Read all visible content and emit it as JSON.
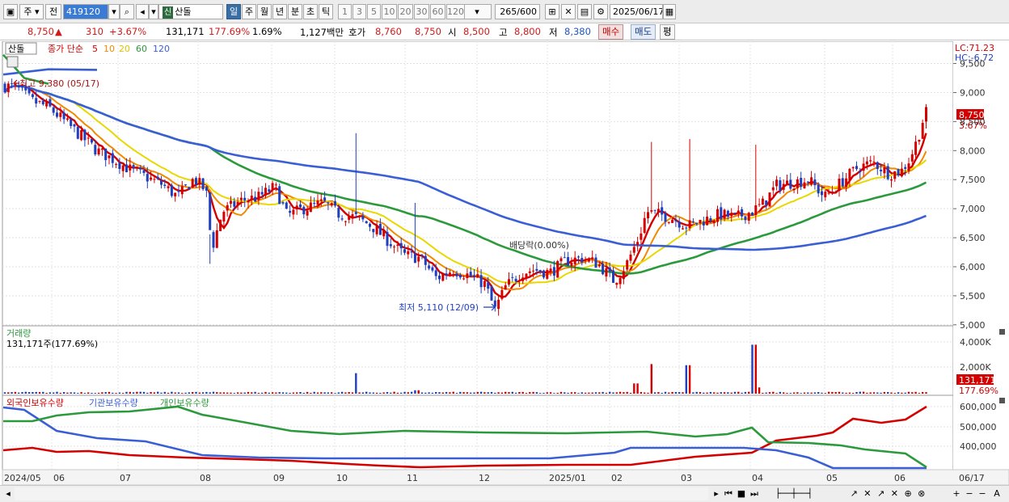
{
  "toolbar": {
    "type_value": "주",
    "type2_value": "전",
    "code_value": "419120",
    "badge": "신",
    "stock_name": "산돌",
    "periods": [
      "일",
      "주",
      "월",
      "년",
      "분",
      "초",
      "틱"
    ],
    "active_period": "일",
    "intervals": [
      "1",
      "3",
      "5",
      "10",
      "20",
      "30",
      "60",
      "120"
    ],
    "count_value": "265",
    "count_total": "/600",
    "date_value": "2025/06/17"
  },
  "info": {
    "price": "8,750",
    "up_arrow": "▲",
    "change": "310",
    "change_pct": "+3.67%",
    "volume": "131,171",
    "volume_pct": "177.69%",
    "turnover_pct": "1.69%",
    "amount": "1,127백만",
    "quote_label": "호가",
    "quote_ask": "8,760",
    "quote_bid": "8,750",
    "open_label": "시",
    "open_value": "8,500",
    "high_label": "고",
    "high_value": "8,800",
    "low_label": "저",
    "low_value": "8,380",
    "buy_button": "매수",
    "sell_button": "매도",
    "eval_button": "평"
  },
  "chart_data": [
    {
      "type": "candlestick",
      "title": "산돌",
      "legend": {
        "prefix": "종가 단순",
        "series": [
          {
            "name": "5",
            "color": "#d40000"
          },
          {
            "name": "10",
            "color": "#f08a00"
          },
          {
            "name": "20",
            "color": "#e8d800"
          },
          {
            "name": "60",
            "color": "#2c9a3c"
          },
          {
            "name": "120",
            "color": "#3a5fd5"
          }
        ]
      },
      "ylim": [
        4900,
        9800
      ],
      "yticks": [
        "9,500",
        "9,000",
        "8,500",
        "8,000",
        "7,500",
        "7,000",
        "6,500",
        "6,000",
        "5,500",
        "5,000"
      ],
      "right_labels": {
        "lc": "LC:71.23",
        "hc": "HC:-6.72",
        "last_price": "8,750",
        "last_pct": "3.67%"
      },
      "annotations": {
        "high": "최고 9,380 (05/17)",
        "low": "최저 5,110 (12/09)",
        "dividend": "배당락(0.00%)"
      },
      "months": [
        "2024/05",
        "06",
        "07",
        "08",
        "09",
        "10",
        "11",
        "12",
        "2025/01",
        "02",
        "03",
        "04",
        "05",
        "06",
        "06/17"
      ],
      "close_approx": [
        {
          "x": "2024/05",
          "close": 9100
        },
        {
          "x": "06",
          "close": 8600
        },
        {
          "x": "07",
          "close": 7700
        },
        {
          "x": "08",
          "close": 7600
        },
        {
          "x": "08 mid",
          "close": 7150
        },
        {
          "x": "09",
          "close": 7250
        },
        {
          "x": "10",
          "close": 6950
        },
        {
          "x": "11",
          "close": 6150
        },
        {
          "x": "12",
          "close": 5500
        },
        {
          "x": "2025/01",
          "close": 6150
        },
        {
          "x": "02",
          "close": 5950
        },
        {
          "x": "03",
          "close": 6900
        },
        {
          "x": "04",
          "close": 7000
        },
        {
          "x": "05",
          "close": 7600
        },
        {
          "x": "06",
          "close": 7700
        },
        {
          "x": "06/17",
          "close": 8750
        }
      ]
    },
    {
      "type": "bar",
      "title": "거래량",
      "current": "131,171주(177.69%)",
      "yticks": [
        "4,000K",
        "2,000K"
      ],
      "right_labels": {
        "value": "131,171",
        "pct": "177.69%"
      }
    },
    {
      "type": "line",
      "series": [
        {
          "name": "외국인보유수량",
          "color": "#d40000"
        },
        {
          "name": "기관보유수량",
          "color": "#3a5fd5"
        },
        {
          "name": "개인보유수량",
          "color": "#2c9a3c"
        }
      ],
      "yticks": [
        "600,000",
        "500,000",
        "400,000"
      ]
    }
  ],
  "colors": {
    "up": "#d40000",
    "down": "#1f3fbf",
    "toolbar_active": "#3a6ea5"
  },
  "icons": [
    "window-icon",
    "dropdown-icon",
    "search-icon",
    "speaker-icon",
    "grid-icon",
    "cross-icon",
    "save-icon",
    "gear-icon",
    "calendar-icon"
  ]
}
